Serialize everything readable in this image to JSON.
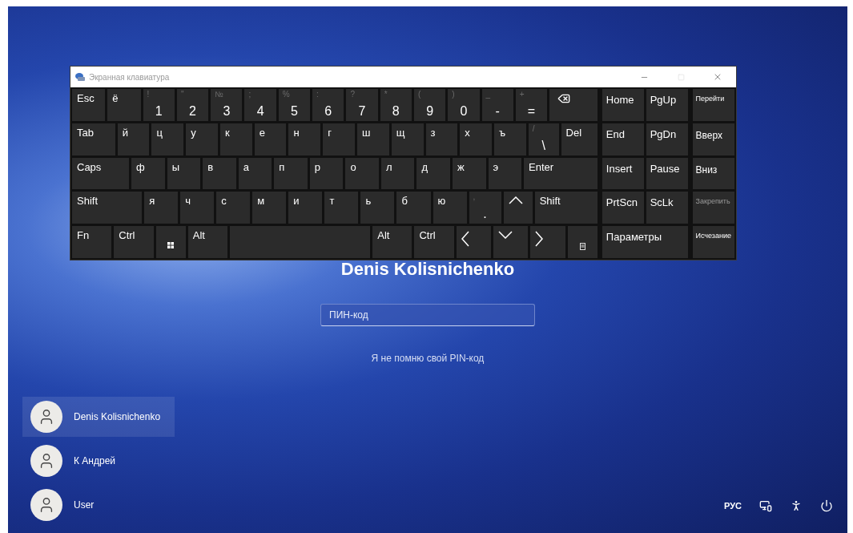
{
  "keyboard_window": {
    "title": "Экранная клавиатура",
    "title_buttons": [
      {
        "kind": "minimize",
        "disabled": false
      },
      {
        "kind": "maximize",
        "disabled": true
      },
      {
        "kind": "close",
        "disabled": false
      }
    ],
    "main_rows": [
      [
        {
          "kind": "text",
          "label": "Esc"
        },
        {
          "kind": "text",
          "label": "ё"
        },
        {
          "kind": "digit",
          "shift": "!",
          "label": "1"
        },
        {
          "kind": "digit",
          "shift": "\"",
          "label": "2"
        },
        {
          "kind": "digit",
          "shift": "№",
          "label": "3"
        },
        {
          "kind": "digit",
          "shift": ";",
          "label": "4"
        },
        {
          "kind": "digit",
          "shift": "%",
          "label": "5"
        },
        {
          "kind": "digit",
          "shift": ":",
          "label": "6"
        },
        {
          "kind": "digit",
          "shift": "?",
          "label": "7"
        },
        {
          "kind": "digit",
          "shift": "*",
          "label": "8"
        },
        {
          "kind": "digit",
          "shift": "(",
          "label": "9"
        },
        {
          "kind": "digit",
          "shift": ")",
          "label": "0"
        },
        {
          "kind": "digit",
          "shift": "_",
          "label": "-"
        },
        {
          "kind": "digit",
          "shift": "+",
          "label": "="
        },
        {
          "kind": "backspace"
        }
      ],
      [
        {
          "kind": "text",
          "label": "Tab"
        },
        {
          "kind": "text",
          "label": "й"
        },
        {
          "kind": "text",
          "label": "ц"
        },
        {
          "kind": "text",
          "label": "у"
        },
        {
          "kind": "text",
          "label": "к"
        },
        {
          "kind": "text",
          "label": "е"
        },
        {
          "kind": "text",
          "label": "н"
        },
        {
          "kind": "text",
          "label": "г"
        },
        {
          "kind": "text",
          "label": "ш"
        },
        {
          "kind": "text",
          "label": "щ"
        },
        {
          "kind": "text",
          "label": "з"
        },
        {
          "kind": "text",
          "label": "х"
        },
        {
          "kind": "text",
          "label": "ъ"
        },
        {
          "kind": "digit",
          "shift": "/",
          "label": "\\"
        },
        {
          "kind": "text",
          "label": "Del"
        }
      ],
      [
        {
          "kind": "text",
          "label": "Caps"
        },
        {
          "kind": "text",
          "label": "ф"
        },
        {
          "kind": "text",
          "label": "ы"
        },
        {
          "kind": "text",
          "label": "в"
        },
        {
          "kind": "text",
          "label": "а"
        },
        {
          "kind": "text",
          "label": "п"
        },
        {
          "kind": "text",
          "label": "р"
        },
        {
          "kind": "text",
          "label": "о"
        },
        {
          "kind": "text",
          "label": "л"
        },
        {
          "kind": "text",
          "label": "д"
        },
        {
          "kind": "text",
          "label": "ж"
        },
        {
          "kind": "text",
          "label": "э"
        },
        {
          "kind": "text",
          "label": "Enter"
        }
      ],
      [
        {
          "kind": "text",
          "label": "Shift"
        },
        {
          "kind": "text",
          "label": "я"
        },
        {
          "kind": "text",
          "label": "ч"
        },
        {
          "kind": "text",
          "label": "с"
        },
        {
          "kind": "text",
          "label": "м"
        },
        {
          "kind": "text",
          "label": "и"
        },
        {
          "kind": "text",
          "label": "т"
        },
        {
          "kind": "text",
          "label": "ь"
        },
        {
          "kind": "text",
          "label": "б"
        },
        {
          "kind": "text",
          "label": "ю"
        },
        {
          "kind": "digit",
          "shift": ",",
          "label": "."
        },
        {
          "kind": "up"
        },
        {
          "kind": "text",
          "label": "Shift"
        }
      ],
      [
        {
          "kind": "text",
          "label": "Fn"
        },
        {
          "kind": "text",
          "label": "Ctrl"
        },
        {
          "kind": "windows"
        },
        {
          "kind": "text",
          "label": "Alt"
        },
        {
          "kind": "space"
        },
        {
          "kind": "text",
          "label": "Alt"
        },
        {
          "kind": "text",
          "label": "Ctrl"
        },
        {
          "kind": "left"
        },
        {
          "kind": "down"
        },
        {
          "kind": "right"
        },
        {
          "kind": "menu"
        }
      ]
    ],
    "nav_keys": [
      {
        "label": "Home"
      },
      {
        "label": "PgUp"
      },
      {
        "label": "End"
      },
      {
        "label": "PgDn"
      },
      {
        "label": "Insert"
      },
      {
        "label": "Pause"
      },
      {
        "label": "PrtScn"
      },
      {
        "label": "ScLk"
      },
      {
        "label": "Параметры"
      }
    ],
    "side_keys": [
      {
        "label": "Перейти",
        "disabled": false
      },
      {
        "label": "Вверх",
        "disabled": false
      },
      {
        "label": "Вниз",
        "disabled": false
      },
      {
        "label": "Закрепить",
        "disabled": true
      },
      {
        "label": "Исчезание",
        "disabled": false
      }
    ]
  },
  "lock_screen": {
    "user_name": "Denis Kolisnichenko",
    "pin_field": {
      "placeholder": "ПИН-код"
    },
    "forgot_link": "Я не помню свой PIN-код",
    "users": [
      {
        "name": "Denis Kolisnichenko",
        "selected": true
      },
      {
        "name": "К Андрей",
        "selected": false
      },
      {
        "name": "User",
        "selected": false
      }
    ],
    "language": "РУС"
  }
}
